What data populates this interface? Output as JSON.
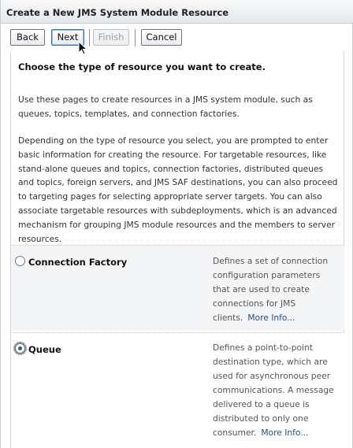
{
  "window": {
    "title": "Create a New JMS System Module Resource"
  },
  "toolbar": {
    "back_label": "Back",
    "next_label": "Next",
    "finish_label": "Finish",
    "cancel_label": "Cancel"
  },
  "content": {
    "heading": "Choose the type of resource you want to create.",
    "intro": "Use these pages to create resources in a JMS system module, such as queues, topics, templates, and connection factories.",
    "details": "Depending on the type of resource you select, you are prompted to enter basic information for creating the resource. For targetable resources, like stand-alone queues and topics, connection factories, distributed queues and topics, foreign servers, and JMS SAF destinations, you can also proceed to targeting pages for selecting appropriate server targets. You can also associate targetable resources with subdeployments, which is an advanced mechanism for grouping JMS module resources and the members to server resources."
  },
  "options": [
    {
      "label": "Connection Factory",
      "selected": false,
      "description": "Defines a set of connection configuration parameters that are used to create connections for JMS clients.",
      "more_link": "More Info..."
    },
    {
      "label": "Queue",
      "selected": true,
      "description": "Defines a point-to-point destination type, which are used for asynchronous peer communications. A message delivered to a queue is distributed to only one consumer.",
      "more_link": "More Info..."
    }
  ],
  "colors": {
    "link": "#1f4f8f",
    "selected_radio": "#2a5d99",
    "row_shade": "#f4f5f6"
  }
}
